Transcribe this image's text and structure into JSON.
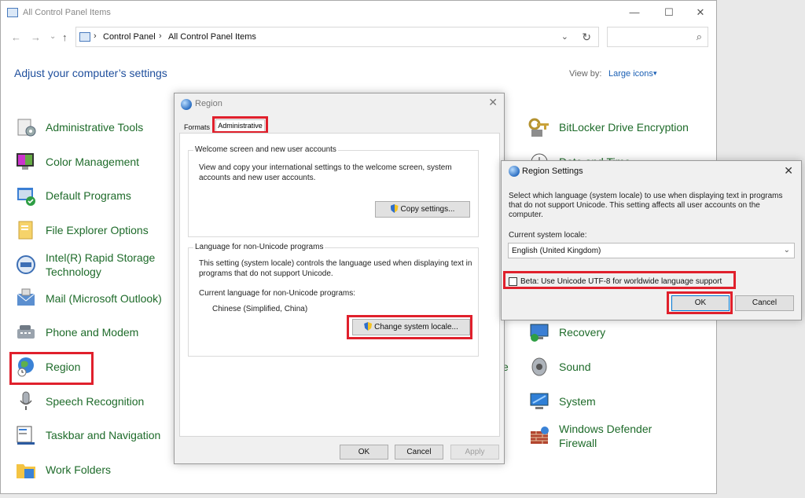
{
  "window": {
    "title": "All Control Panel Items",
    "minimize": "—",
    "maximize": "☐",
    "close": "✕"
  },
  "nav": {
    "back": "←",
    "forward": "→",
    "recent": "⌄",
    "up": "↑",
    "breadcrumb": [
      "Control Panel",
      "All Control Panel Items"
    ],
    "separator": "›",
    "dropdown": "⌄",
    "refresh": "↻",
    "search_placeholder": "",
    "search_icon": "⌕"
  },
  "header": {
    "heading": "Adjust your computer’s settings",
    "view_by_label": "View by:",
    "view_by_value": "Large icons",
    "view_by_caret": "▾"
  },
  "items_left": [
    {
      "label": "Administrative Tools",
      "icon": "admin-tools-icon"
    },
    {
      "label": "Color Management",
      "icon": "color-management-icon"
    },
    {
      "label": "Default Programs",
      "icon": "default-programs-icon"
    },
    {
      "label": "File Explorer Options",
      "icon": "file-explorer-options-icon"
    },
    {
      "label": "Intel(R) Rapid Storage Technology",
      "icon": "intel-rst-icon"
    },
    {
      "label": "Mail (Microsoft Outlook)",
      "icon": "mail-icon"
    },
    {
      "label": "Phone and Modem",
      "icon": "phone-modem-icon"
    },
    {
      "label": "Region",
      "icon": "region-icon"
    },
    {
      "label": "Speech Recognition",
      "icon": "microphone-icon"
    },
    {
      "label": "Taskbar and Navigation",
      "icon": "taskbar-icon"
    },
    {
      "label": "Work Folders",
      "icon": "work-folders-icon"
    }
  ],
  "items_right": [
    {
      "label": "BitLocker Drive Encryption",
      "icon": "bitlocker-icon"
    },
    {
      "label": "Date and Time",
      "icon": "date-time-icon"
    },
    {
      "label": "Recovery",
      "icon": "recovery-icon"
    },
    {
      "label": "Sound",
      "icon": "sound-icon"
    },
    {
      "label": "System",
      "icon": "system-icon"
    },
    {
      "label": "Windows Defender Firewall",
      "icon": "firewall-icon"
    }
  ],
  "partial_letter": "e",
  "region_dialog": {
    "title": "Region",
    "close": "✕",
    "tabs": [
      "Formats",
      "Administrative"
    ],
    "welcome_group": {
      "title": "Welcome screen and new user accounts",
      "text": "View and copy your international settings to the welcome screen, system accounts and new user accounts.",
      "button": "Copy settings..."
    },
    "unicode_group": {
      "title": "Language for non-Unicode programs",
      "text": "This setting (system locale) controls the language used when displaying text in programs that do not support Unicode.",
      "current_label": "Current language for non-Unicode programs:",
      "current_value": "Chinese (Simplified, China)",
      "button": "Change system locale..."
    },
    "ok": "OK",
    "cancel": "Cancel",
    "apply": "Apply"
  },
  "region_settings": {
    "title": "Region Settings",
    "close": "✕",
    "description": "Select which language (system locale) to use when displaying text in programs that do not support Unicode. This setting affects all user accounts on the computer.",
    "current_label": "Current system locale:",
    "locale_value": "English (United Kingdom)",
    "combo_arrow": "⌄",
    "beta_label": "Beta: Use Unicode UTF-8 for worldwide language support",
    "beta_checked": false,
    "ok": "OK",
    "cancel": "Cancel"
  },
  "colors": {
    "link_green": "#1e6b2a",
    "heading_blue": "#1e4e9c",
    "highlight_red": "#e0202c"
  }
}
